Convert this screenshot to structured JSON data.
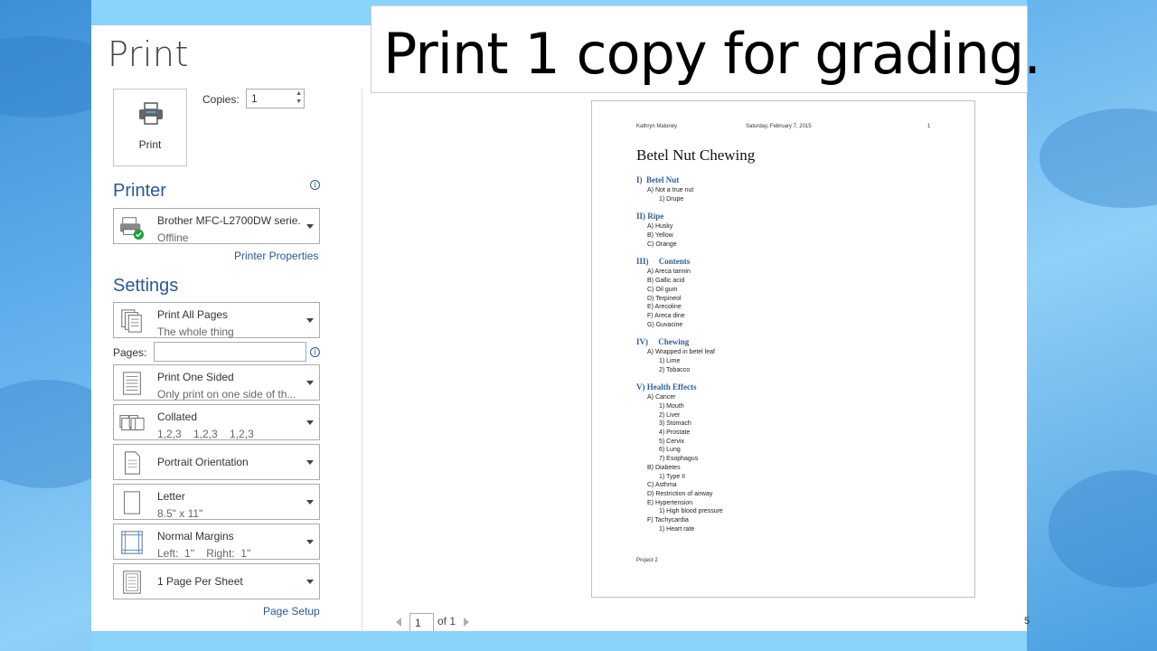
{
  "backstage": {
    "title": "Print",
    "print_button_label": "Print",
    "copies_label": "Copies:",
    "copies_value": "1"
  },
  "printer": {
    "heading": "Printer",
    "name": "Brother MFC-L2700DW serie...",
    "status": "Offline",
    "properties_link": "Printer Properties"
  },
  "settings": {
    "heading": "Settings",
    "pages_label": "Pages:",
    "pages_value": "",
    "items": [
      {
        "line1": "Print All Pages",
        "line2": "The whole thing",
        "icon": "pages-icon"
      },
      {
        "line1": "Print One Sided",
        "line2": "Only print on one side of th...",
        "icon": "one-sided-icon"
      },
      {
        "line1": "Collated",
        "line2": "1,2,3    1,2,3    1,2,3",
        "icon": "collated-icon"
      },
      {
        "line1": "Portrait Orientation",
        "line2": "",
        "icon": "portrait-icon"
      },
      {
        "line1": "Letter",
        "line2": "8.5\" x 11\"",
        "icon": "letter-icon"
      },
      {
        "line1": "Normal Margins",
        "line2": "Left:  1\"    Right:  1\"",
        "icon": "margins-icon"
      },
      {
        "line1": "1 Page Per Sheet",
        "line2": "",
        "icon": "page-per-sheet-icon"
      }
    ],
    "page_setup_link": "Page Setup"
  },
  "preview": {
    "header_author": "Kathryn Maloney",
    "header_date": "Saturday, February 7, 2015",
    "header_page": "1",
    "doc_title": "Betel Nut Chewing",
    "footer": "Project 2",
    "sections": [
      {
        "heading": "I)  Betel Nut",
        "items": [
          {
            "level": 1,
            "text": "A)  Not a true nut"
          },
          {
            "level": 2,
            "text": "1)  Drupe"
          }
        ]
      },
      {
        "heading": "II) Ripe",
        "items": [
          {
            "level": 1,
            "text": "A)  Husky"
          },
          {
            "level": 1,
            "text": "B)  Yellow"
          },
          {
            "level": 1,
            "text": "C)  Orange"
          }
        ]
      },
      {
        "heading": "III)     Contents",
        "items": [
          {
            "level": 1,
            "text": "A)  Areca tannin"
          },
          {
            "level": 1,
            "text": "B)  Gallic acid"
          },
          {
            "level": 1,
            "text": "C)  Oil gum"
          },
          {
            "level": 1,
            "text": "D)  Terpineol"
          },
          {
            "level": 1,
            "text": "E)  Arecoline"
          },
          {
            "level": 1,
            "text": "F)  Areca dine"
          },
          {
            "level": 1,
            "text": "G)  Guvacine"
          }
        ]
      },
      {
        "heading": "IV)     Chewing",
        "items": [
          {
            "level": 1,
            "text": "A)  Wrapped in betel leaf"
          },
          {
            "level": 2,
            "text": "1)  Lime"
          },
          {
            "level": 2,
            "text": "2)  Tobacco"
          }
        ]
      },
      {
        "heading": "V) Health Effects",
        "items": [
          {
            "level": 1,
            "text": "A)  Cancer"
          },
          {
            "level": 2,
            "text": "1)  Mouth"
          },
          {
            "level": 2,
            "text": "2)  Liver"
          },
          {
            "level": 2,
            "text": "3)  Stomach"
          },
          {
            "level": 2,
            "text": "4)  Prostate"
          },
          {
            "level": 2,
            "text": "5)  Cervix"
          },
          {
            "level": 2,
            "text": "6)  Lung"
          },
          {
            "level": 2,
            "text": "7)  Esophagus"
          },
          {
            "level": 1,
            "text": "B)  Diabetes"
          },
          {
            "level": 2,
            "text": "1)  Type II"
          },
          {
            "level": 1,
            "text": "C)  Asthma"
          },
          {
            "level": 1,
            "text": "D)  Restriction of airway"
          },
          {
            "level": 1,
            "text": "E)  Hypertension"
          },
          {
            "level": 2,
            "text": "1)  High blood pressure"
          },
          {
            "level": 1,
            "text": "F)  Tachycardia"
          },
          {
            "level": 2,
            "text": "1)  Heart rate"
          }
        ]
      }
    ]
  },
  "navigation": {
    "current_page": "1",
    "of_label": "of 1"
  },
  "banner": {
    "text": "Print 1 copy for grading."
  },
  "edge_text": "5",
  "colors": {
    "accent": "#2b579a",
    "heading": "#2e5f9b",
    "frame": "#8ad3fb"
  }
}
